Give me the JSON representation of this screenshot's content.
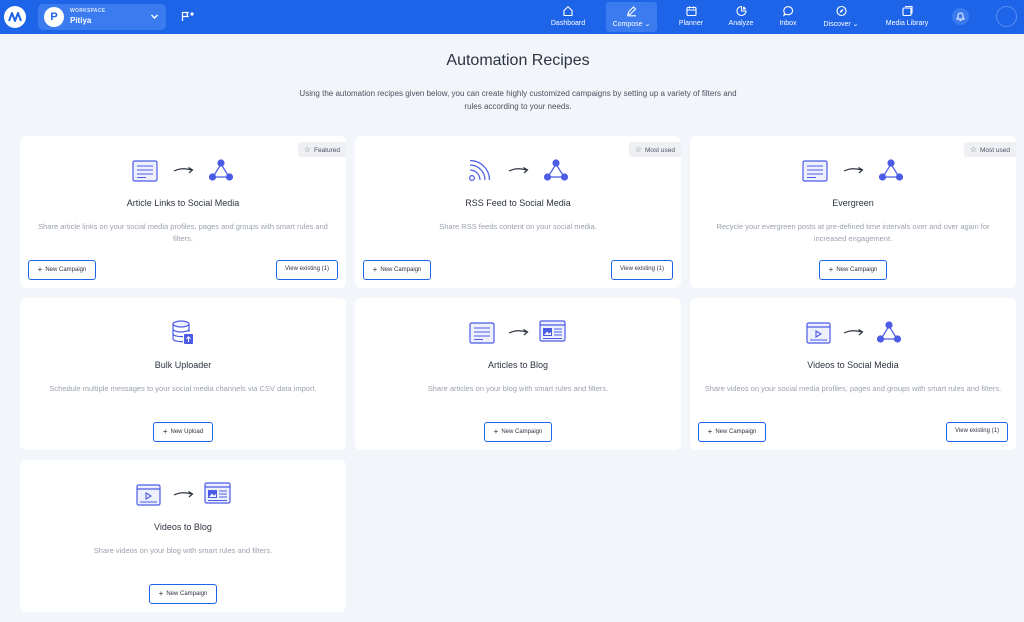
{
  "workspace": {
    "label": "WORKSPACE",
    "name": "Pitiya",
    "avatar_letter": "P"
  },
  "nav": [
    {
      "label": "Dashboard",
      "icon": "home-icon"
    },
    {
      "label": "Compose",
      "icon": "pen-icon",
      "active": true
    },
    {
      "label": "Planner",
      "icon": "calendar-icon"
    },
    {
      "label": "Analyze",
      "icon": "chart-icon"
    },
    {
      "label": "Inbox",
      "icon": "chat-icon"
    },
    {
      "label": "Discover",
      "icon": "compass-icon"
    },
    {
      "label": "Media Library",
      "icon": "media-icon"
    }
  ],
  "page": {
    "title": "Automation Recipes",
    "description": "Using the automation recipes given below, you can create highly customized campaigns by setting up a variety of filters and rules according to your needs."
  },
  "recipes": [
    {
      "title": "Article Links to Social Media",
      "description": "Share article links on your social media profiles, pages and groups with smart rules and filters.",
      "tag": "Featured",
      "primary": "New Campaign",
      "secondary": "View existing (1)"
    },
    {
      "title": "RSS Feed to Social Media",
      "description": "Share RSS feeds content on your social media.",
      "tag": "Most used",
      "primary": "New Campaign",
      "secondary": "View existing (1)"
    },
    {
      "title": "Evergreen",
      "description": "Recycle your evergreen posts at pre-defined time intervals over and over again for increased engagement.",
      "tag": "Most used",
      "primary": "New Campaign"
    },
    {
      "title": "Bulk Uploader",
      "description": "Schedule multiple messages to your social media channels via CSV data import.",
      "primary": "New Upload"
    },
    {
      "title": "Articles to Blog",
      "description": "Share articles on your blog with smart rules and filters.",
      "primary": "New Campaign"
    },
    {
      "title": "Videos to Social Media",
      "description": "Share videos on your social media profiles, pages and groups with smart rules and filters.",
      "primary": "New Campaign",
      "secondary": "View existing (1)"
    },
    {
      "title": "Videos to Blog",
      "description": "Share videos on your blog with smart rules and filters.",
      "primary": "New Campaign"
    }
  ],
  "colors": {
    "brand": "#1d64e9",
    "icon": "#4b5be6",
    "background": "#f2f5fa"
  }
}
